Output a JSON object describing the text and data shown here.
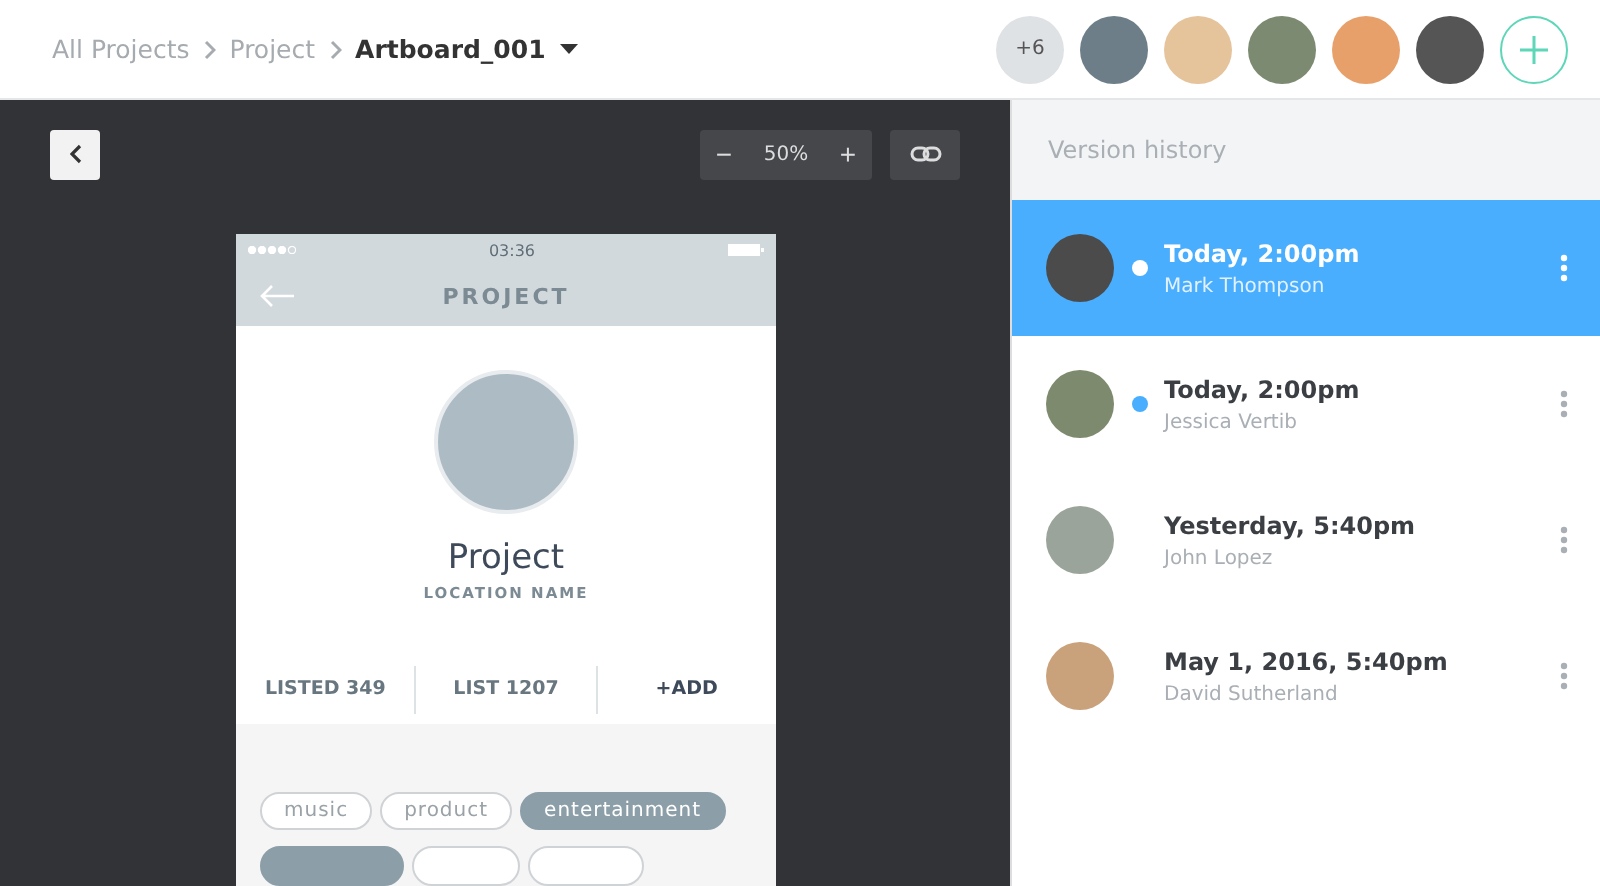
{
  "breadcrumbs": [
    {
      "label": "All Projects",
      "current": false
    },
    {
      "label": "Project",
      "current": false
    },
    {
      "label": "Artboard_001",
      "current": true
    }
  ],
  "collaborators": {
    "more": "+6"
  },
  "toolbar": {
    "zoom": "50%",
    "minus": "−",
    "plus": "+"
  },
  "artboard": {
    "status_time": "03:36",
    "nav_title": "PROJECT",
    "name": "Project",
    "location": "LOCATION NAME",
    "stats": [
      {
        "label": "LISTED",
        "value": "349"
      },
      {
        "label": "LIST",
        "value": "1207"
      }
    ],
    "add": "+ADD",
    "tags": [
      {
        "label": "music",
        "selected": false
      },
      {
        "label": "product",
        "selected": false
      },
      {
        "label": "entertainment",
        "selected": true
      }
    ],
    "tags_row_2": [
      {
        "selected": true
      },
      {
        "selected": false
      },
      {
        "selected": false
      }
    ]
  },
  "version_history": {
    "title": "Version history",
    "items": [
      {
        "time": "Today, 2:00pm",
        "author": "Mark Thompson",
        "selected": true,
        "unread": true
      },
      {
        "time": "Today, 2:00pm",
        "author": "Jessica Vertib",
        "selected": false,
        "unread": true
      },
      {
        "time": "Yesterday, 5:40pm",
        "author": "John Lopez",
        "selected": false,
        "unread": false
      },
      {
        "time": "May 1, 2016, 5:40pm",
        "author": "David Sutherland",
        "selected": false,
        "unread": false
      }
    ]
  }
}
